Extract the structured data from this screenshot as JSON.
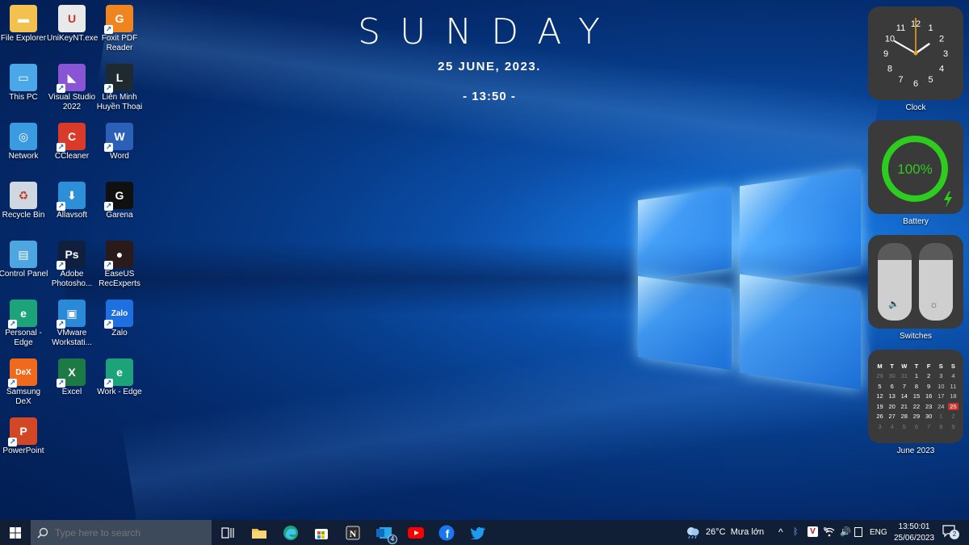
{
  "desktop_icons": [
    {
      "label": "File Explorer",
      "icon": "folder-icon",
      "color": "#f2c14e"
    },
    {
      "label": "UniKeyNT.exe",
      "icon": "unikey-icon",
      "color": "#e9e9e9"
    },
    {
      "label": "Foxit PDF Reader",
      "icon": "foxit-icon",
      "color": "#f0851f"
    },
    {
      "label": "This PC",
      "icon": "computer-icon",
      "color": "#4aa8e8"
    },
    {
      "label": "Visual Studio 2022",
      "icon": "visual-studio-icon",
      "color": "#8a55d4"
    },
    {
      "label": "Liên Minh Huyền Thoại",
      "icon": "league-icon",
      "color": "#1f2a30"
    },
    {
      "label": "Network",
      "icon": "network-icon",
      "color": "#3b9be0"
    },
    {
      "label": "CCleaner",
      "icon": "ccleaner-icon",
      "color": "#d93a2a"
    },
    {
      "label": "Word",
      "icon": "word-icon",
      "color": "#2b5fb8"
    },
    {
      "label": "Recycle Bin",
      "icon": "recycle-bin-icon",
      "color": "#cfd8e0"
    },
    {
      "label": "Allavsoft",
      "icon": "allavsoft-icon",
      "color": "#2d8fd8"
    },
    {
      "label": "Garena",
      "icon": "garena-icon",
      "color": "#101010"
    },
    {
      "label": "Control Panel",
      "icon": "control-panel-icon",
      "color": "#4da6e0"
    },
    {
      "label": "Adobe Photosho...",
      "icon": "photoshop-icon",
      "color": "#0f1f3d"
    },
    {
      "label": "EaseUS RecExperts",
      "icon": "easeus-icon",
      "color": "#2a1a1a"
    },
    {
      "label": "Personal - Edge",
      "icon": "edge-icon",
      "color": "#1da37a"
    },
    {
      "label": "VMware Workstati...",
      "icon": "vmware-icon",
      "color": "#2a8ad8"
    },
    {
      "label": "Zalo",
      "icon": "zalo-icon",
      "color": "#1e6fe0"
    },
    {
      "label": "Samsung DeX",
      "icon": "dex-icon",
      "color": "#f06a1e"
    },
    {
      "label": "Excel",
      "icon": "excel-icon",
      "color": "#1d7a45"
    },
    {
      "label": "Work - Edge",
      "icon": "edge-icon",
      "color": "#1da37a"
    },
    {
      "label": "PowerPoint",
      "icon": "powerpoint-icon",
      "color": "#d24726"
    }
  ],
  "center_clock": {
    "day": "SUNDAY",
    "date": "25 JUNE, 2023.",
    "time": "- 13:50 -"
  },
  "widgets": {
    "clock": {
      "label": "Clock",
      "numbers": [
        "12",
        "1",
        "2",
        "3",
        "4",
        "5",
        "6",
        "7",
        "8",
        "9",
        "10",
        "11"
      ],
      "hour": 13,
      "minute": 50
    },
    "battery": {
      "label": "Battery",
      "percent_text": "100%",
      "level": 1.0,
      "ring_color": "#2ecc1e"
    },
    "switches": {
      "label": "Switches",
      "volume_level": 0.78,
      "brightness_level": 0.78
    },
    "calendar": {
      "label": "June 2023",
      "weekdays": [
        "M",
        "T",
        "W",
        "T",
        "F",
        "S",
        "S"
      ],
      "weeks": [
        [
          "29",
          "30",
          "31",
          "1",
          "2",
          "3",
          "4"
        ],
        [
          "5",
          "6",
          "7",
          "8",
          "9",
          "10",
          "11"
        ],
        [
          "12",
          "13",
          "14",
          "15",
          "16",
          "17",
          "18"
        ],
        [
          "19",
          "20",
          "21",
          "22",
          "23",
          "24",
          "25"
        ],
        [
          "26",
          "27",
          "28",
          "29",
          "30",
          "1",
          "2"
        ],
        [
          "3",
          "4",
          "5",
          "6",
          "7",
          "8",
          "9"
        ]
      ],
      "today": "25",
      "accent": "#d32f2f"
    }
  },
  "taskbar": {
    "search_placeholder": "Type here to search",
    "apps": [
      "task-view-icon",
      "file-explorer-icon",
      "edge-icon",
      "store-icon",
      "notion-icon",
      "outlook-icon",
      "youtube-icon",
      "facebook-icon",
      "twitter-icon"
    ],
    "outlook_badge": "4",
    "weather": "26°C  Mưa lớn",
    "language": "ENG",
    "clock_time": "13:50:01",
    "clock_date": "25/06/2023",
    "notification_count": "2"
  }
}
